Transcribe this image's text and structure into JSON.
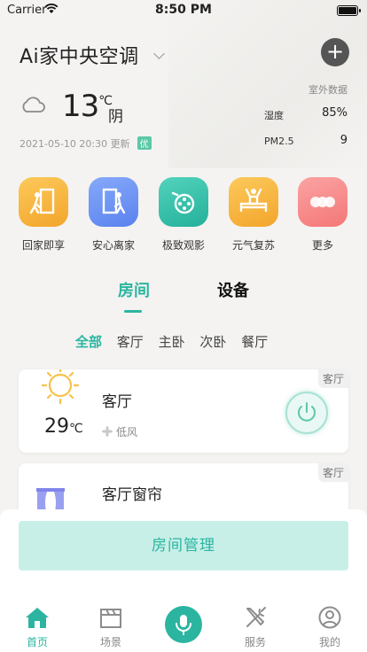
{
  "status_bar": {
    "carrier": "Carrier",
    "time": "8:50 PM"
  },
  "header": {
    "title": "Ai家中央空调",
    "add_icon": "plus-icon"
  },
  "weather": {
    "temperature": "13",
    "unit": "℃",
    "condition": "阴",
    "updated": "2021-05-10 20:30 更新",
    "air_quality": "优",
    "outdoor_label": "室外数据",
    "humidity_label": "湿度",
    "humidity_value": "85%",
    "pm25_label": "PM2.5",
    "pm25_value": "9"
  },
  "scenes": [
    {
      "label": "回家即享",
      "icon": "home-arrive-icon",
      "color": "#f5b63e"
    },
    {
      "label": "安心离家",
      "icon": "leave-home-icon",
      "color": "#6d95f5"
    },
    {
      "label": "极致观影",
      "icon": "movie-icon",
      "color": "#37c3ae"
    },
    {
      "label": "元气复苏",
      "icon": "wake-up-icon",
      "color": "#f5b63e"
    },
    {
      "label": "更多",
      "icon": "more-icon",
      "color": "#f78b8b"
    }
  ],
  "tabs": {
    "rooms": "房间",
    "devices": "设备"
  },
  "filters": [
    "全部",
    "客厅",
    "主卧",
    "次卧",
    "餐厅"
  ],
  "devices": [
    {
      "room": "客厅",
      "name": "客厅",
      "temperature": "29",
      "unit": "℃",
      "fan": "低风"
    },
    {
      "room": "客厅",
      "name": "客厅窗帘"
    }
  ],
  "manage_button": "房间管理",
  "nav": {
    "home": "首页",
    "scenes": "场景",
    "services": "服务",
    "mine": "我的"
  },
  "colors": {
    "accent": "#2bb5a0",
    "background": "#f4f3f1"
  }
}
